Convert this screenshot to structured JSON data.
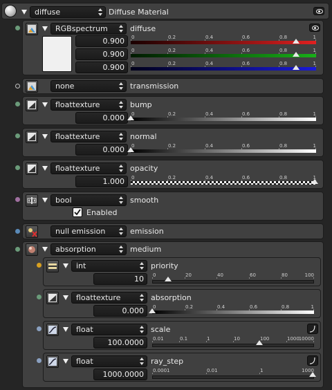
{
  "header": {
    "type_value": "diffuse",
    "title": "Diffuse Material"
  },
  "colors": {
    "red": "#e02020",
    "green": "#18b018",
    "blue": "#1a1ad8"
  },
  "ruler01": [
    "0",
    "0.2",
    "0.4",
    "0.6",
    "0.8",
    "1"
  ],
  "diffuse": {
    "type": "RGBspectrum",
    "label": "diffuse",
    "swatch_color": "#e6e6e6",
    "r": "0.900",
    "g": "0.900",
    "b": "0.900",
    "slider": 0.9
  },
  "transmission": {
    "type": "none",
    "label": "transmission"
  },
  "bump": {
    "type": "floattexture",
    "label": "bump",
    "value": "0.000",
    "slider": 0.0
  },
  "normal": {
    "type": "floattexture",
    "label": "normal",
    "value": "0.000",
    "slider": 0.0
  },
  "opacity": {
    "type": "floattexture",
    "label": "opacity",
    "value": "1.000",
    "slider": 1.0
  },
  "smooth": {
    "type": "bool",
    "label": "smooth",
    "checkbox_label": "Enabled",
    "checked": true
  },
  "emission": {
    "type": "null emission",
    "label": "emission"
  },
  "medium": {
    "type": "absorption",
    "label": "medium",
    "priority": {
      "type": "int",
      "label": "priority",
      "value": "10",
      "ticks": [
        "0",
        "20",
        "40",
        "60",
        "80",
        "100"
      ],
      "slider": 0.1
    },
    "absorption": {
      "type": "floattexture",
      "label": "absorption",
      "value": "0.000",
      "slider": 0.0
    },
    "scale": {
      "type": "float",
      "label": "scale",
      "value": "100.0000",
      "ticks": [
        "0.01",
        "0.1",
        "1",
        "10",
        "100",
        "1000",
        "10000"
      ],
      "slider": 0.667
    },
    "ray_step": {
      "type": "float",
      "label": "ray_step",
      "value": "1000.0000",
      "ticks": [
        "0.0001",
        "0.01",
        "1",
        "1000"
      ],
      "slider": 1.0
    }
  }
}
